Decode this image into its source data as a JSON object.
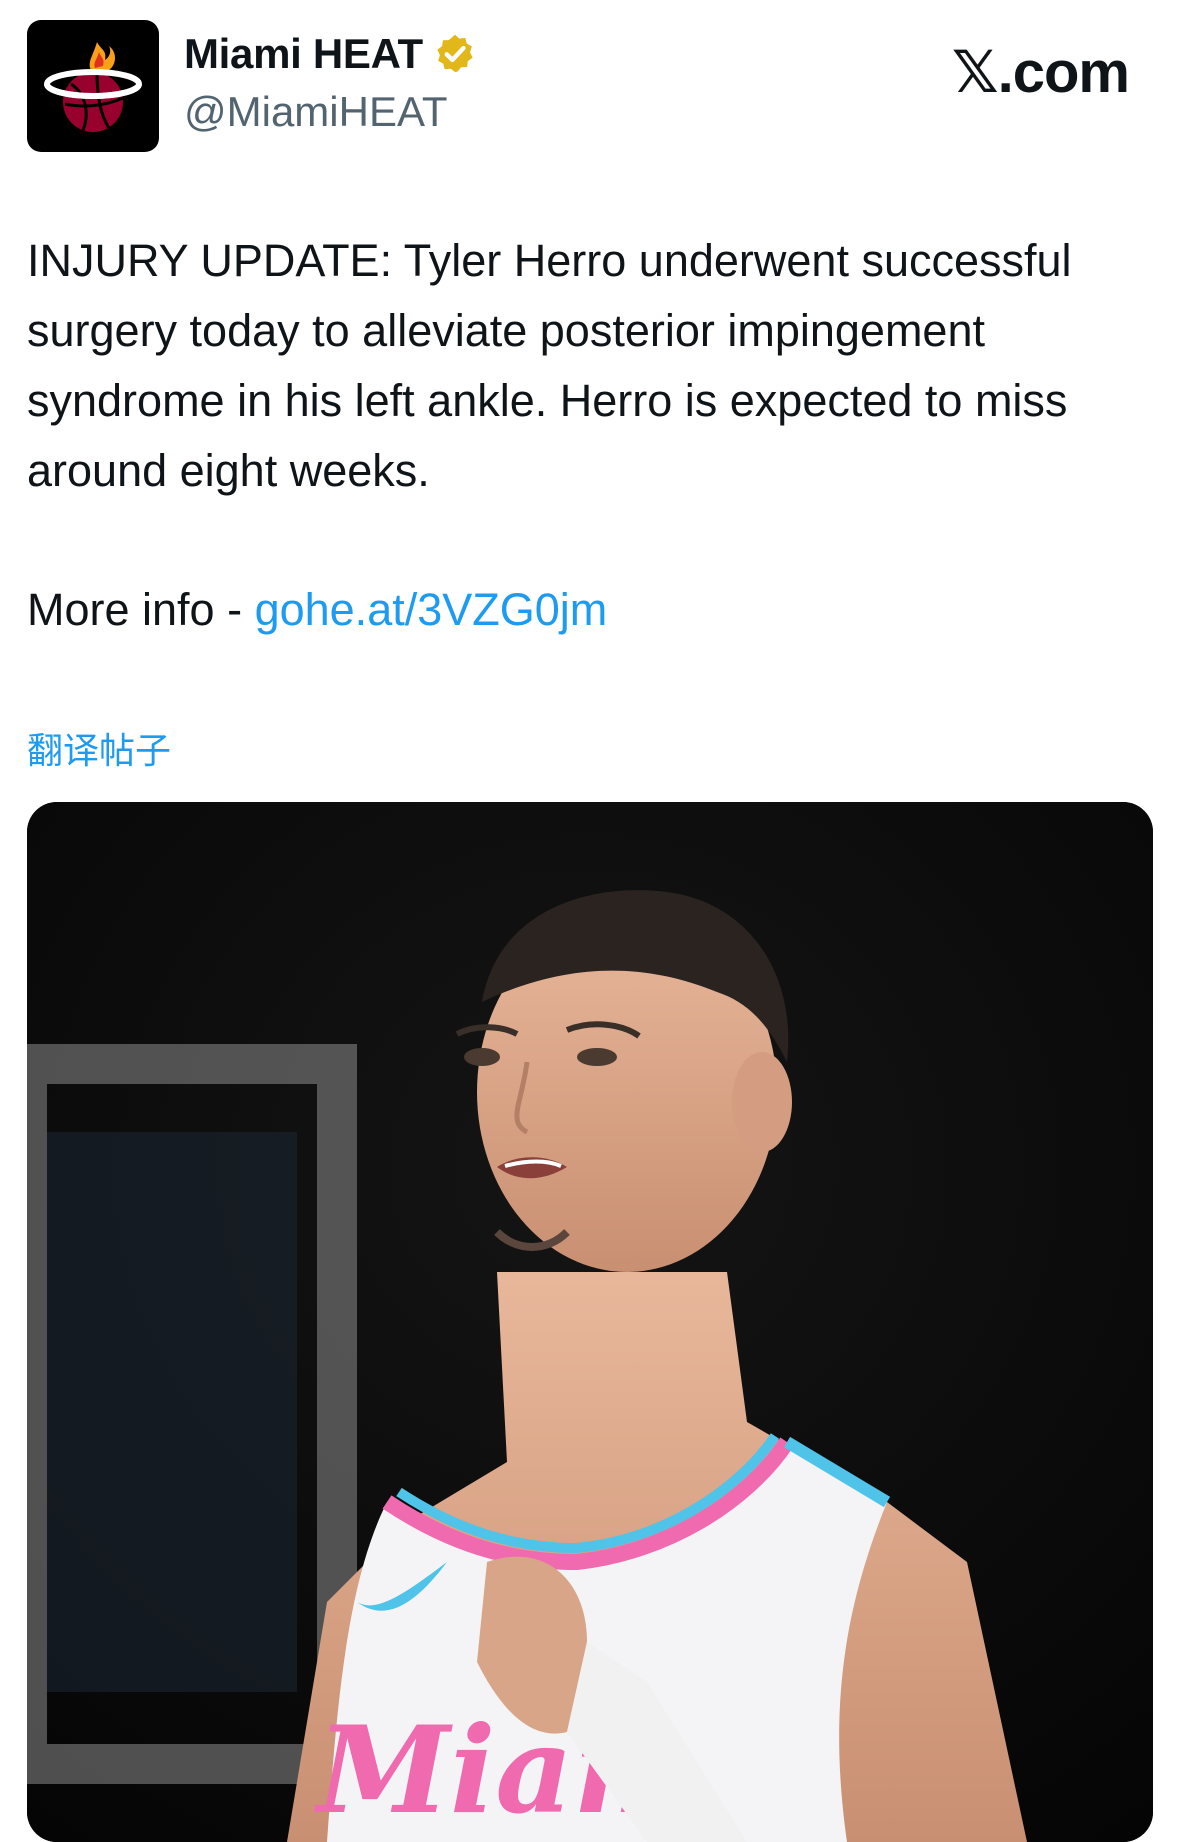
{
  "account": {
    "display_name": "Miami HEAT",
    "handle": "@MiamiHEAT",
    "verified_icon": "verified-badge-gold",
    "avatar_icon": "miami-heat-logo"
  },
  "site": {
    "logo_text": ".com",
    "logo_glyph": "𝕏"
  },
  "tweet": {
    "body": "INJURY UPDATE: Tyler Herro underwent successful surgery today to alleviate posterior impingement syndrome in his left ankle. Herro is expected to miss around eight weeks.",
    "more_info_label": "More info - ",
    "link_text": "gohe.at/3VZG0jm"
  },
  "translate_label": "翻译帖子",
  "media": {
    "description_icon": "player-photo"
  },
  "colors": {
    "link": "#1d9bf0",
    "verified": "#e2b719",
    "heat_red": "#98002e"
  }
}
